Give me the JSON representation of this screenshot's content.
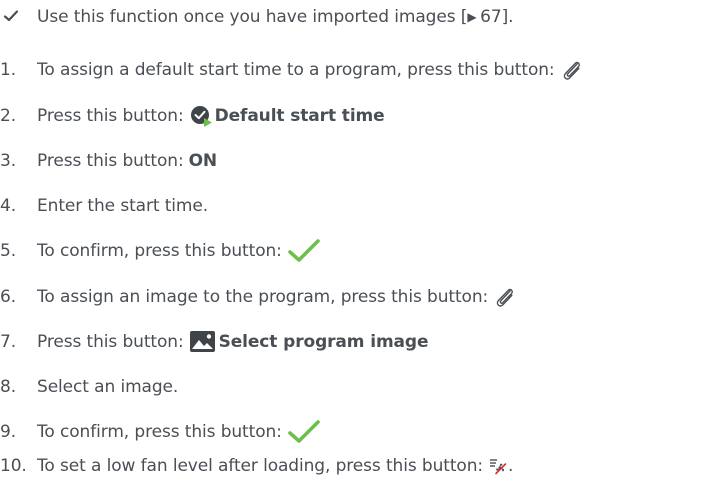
{
  "intro": {
    "text_before": "Use this function once you have imported images [",
    "page_ref": "67",
    "text_after": "]."
  },
  "steps": [
    {
      "number": "1.",
      "text": "To assign a default start time to a program, press this button:",
      "icon": "paperclip-icon"
    },
    {
      "number": "2.",
      "text": "Press this button:",
      "icon": "default-start-time-icon",
      "button_label": "Default start time"
    },
    {
      "number": "3.",
      "text": "Press this button:",
      "button_label": "ON"
    },
    {
      "number": "4.",
      "text": "Enter the start time."
    },
    {
      "number": "5.",
      "text": "To confirm, press this button:",
      "icon": "checkmark-icon"
    },
    {
      "number": "6.",
      "text": "To assign an image to the program, press this button:",
      "icon": "paperclip-icon"
    },
    {
      "number": "7.",
      "text": "Press this button:",
      "icon": "image-icon",
      "button_label": "Select program image"
    },
    {
      "number": "8.",
      "text": "Select an image."
    },
    {
      "number": "9.",
      "text": "To confirm, press this button:",
      "icon": "checkmark-icon"
    },
    {
      "number": "10.",
      "text": "To set a low fan level after loading, press this button:",
      "icon": "fan-off-icon",
      "trailing": "."
    }
  ],
  "colors": {
    "text": "#4a4f55",
    "accent_green": "#6cc04a",
    "icon_dark": "#3f4449"
  }
}
